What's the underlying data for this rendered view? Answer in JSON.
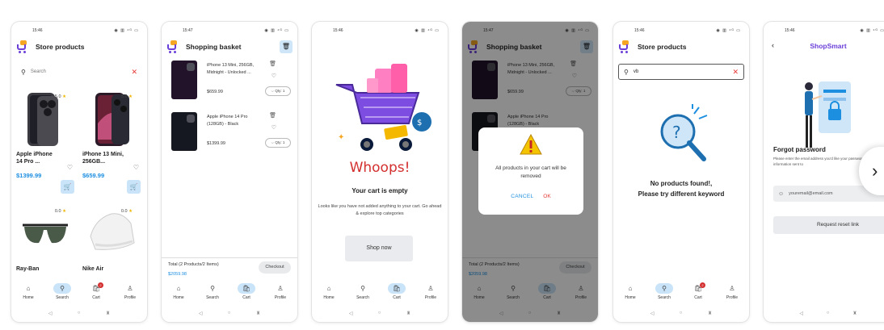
{
  "status": {
    "time1": "15:46",
    "time2": "15:47",
    "icons": "◉ ▥ ⁴ᴳ ▭"
  },
  "store": {
    "title": "Store products",
    "search_placeholder": "Search",
    "products": [
      {
        "name": "Apple iPhone 14 Pro ...",
        "price": "$1399.99",
        "rating": "5.0"
      },
      {
        "name": "iPhone 13 Mini, 256GB...",
        "price": "$659.99",
        "rating": "5.0"
      },
      {
        "name": "Ray-Ban",
        "price": "",
        "rating": "0.0"
      },
      {
        "name": "Nike Air",
        "price": "",
        "rating": "0.0"
      }
    ]
  },
  "basket": {
    "title": "Shopping basket",
    "items": [
      {
        "name": "iPhone 13 Mini, 256GB, Midnight - Unlocked ...",
        "price": "$659.99",
        "qty": "Qty: 1"
      },
      {
        "name": "Apple iPhone 14 Pro (128GB) - Black",
        "price": "$1399.99",
        "qty": "Qty: 1"
      }
    ],
    "total_label": "Total (2 Products/2 Items)",
    "total_value": "$2059.98",
    "checkout": "Checkout"
  },
  "empty": {
    "heading": "Whoops!",
    "subheading": "Your cart is empty",
    "body": "Looks like you have not added anything to your cart. Go ahead & explore top categories",
    "button": "Shop now"
  },
  "dialog": {
    "message": "All products in your cart will be removed",
    "cancel": "CANCEL",
    "ok": "OK"
  },
  "noresults": {
    "title": "Store products",
    "query": "vb",
    "line1": "No products found!,",
    "line2": "Please try different keyword"
  },
  "forgot": {
    "brand": "ShopSmart",
    "heading": "Forgot password",
    "body": "Please enter the email address you'd like your password reset information sent to",
    "email_placeholder": "youremail@email.com",
    "button": "Request reset link"
  },
  "nav": {
    "home": "Home",
    "search": "Search",
    "cart": "Cart",
    "profile": "Profile",
    "badge": "2"
  },
  "colors": {
    "accent": "#1d8fe0",
    "brand": "#6b3fd8",
    "danger": "#e53935",
    "pill": "#c9e3f8"
  }
}
